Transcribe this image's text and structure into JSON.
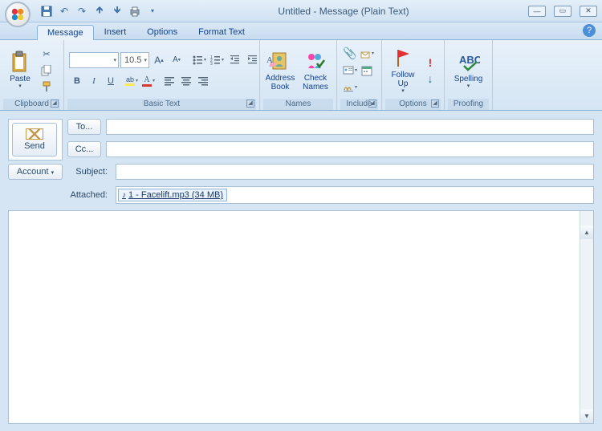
{
  "window": {
    "title": "Untitled - Message (Plain Text)"
  },
  "qat": {
    "save": "save-icon",
    "undo": "↶",
    "redo": "↷",
    "prev": "⬆",
    "next": "⬇",
    "print": "🖶"
  },
  "tabs": {
    "message": "Message",
    "insert": "Insert",
    "options": "Options",
    "format": "Format Text"
  },
  "ribbon": {
    "clipboard": {
      "label": "Clipboard",
      "paste": "Paste"
    },
    "basictext": {
      "label": "Basic Text",
      "font_name": "",
      "font_size": "10.5"
    },
    "names": {
      "label": "Names",
      "address": "Address\nBook",
      "check": "Check\nNames"
    },
    "include": {
      "label": "Include"
    },
    "options": {
      "label": "Options",
      "follow": "Follow\nUp"
    },
    "proofing": {
      "label": "Proofing",
      "spelling": "Spelling"
    }
  },
  "compose": {
    "send": "Send",
    "account": "Account",
    "to": "To...",
    "cc": "Cc...",
    "subject": "Subject:",
    "attached": "Attached:",
    "to_value": "",
    "cc_value": "",
    "subject_value": "",
    "attachment": "1 - Facelift.mp3 (34 MB)"
  }
}
